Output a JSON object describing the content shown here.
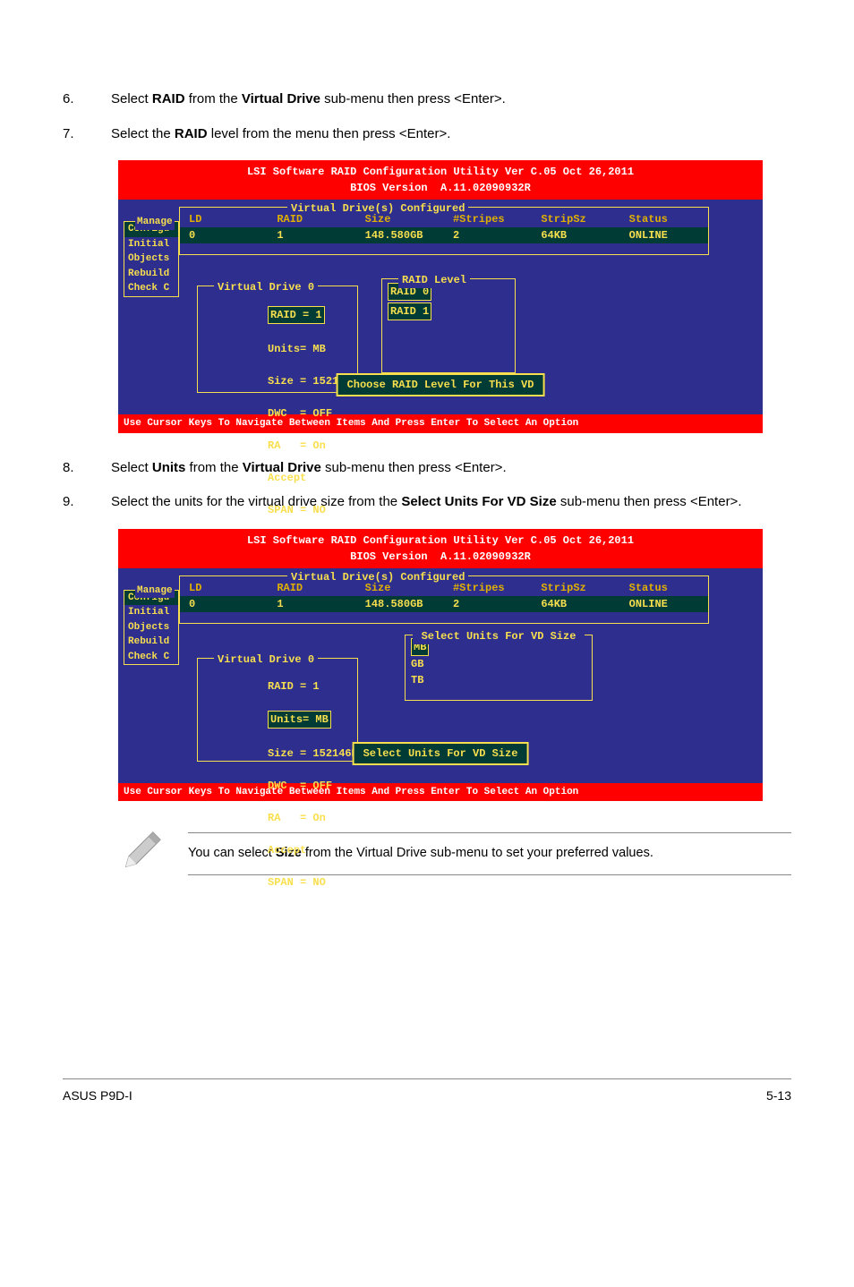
{
  "steps": {
    "s6": {
      "num": "6.",
      "prefix": "Select ",
      "bold1": "RAID",
      "mid": " from the ",
      "bold2": "Virtual Drive",
      "suffix": " sub-menu then press <Enter>."
    },
    "s7": {
      "num": "7.",
      "prefix": "Select the ",
      "bold1": "RAID",
      "suffix": " level from the menu then press <Enter>."
    },
    "s8": {
      "num": "8.",
      "prefix": "Select ",
      "bold1": "Units",
      "mid": " from the ",
      "bold2": "Virtual Drive",
      "suffix": " sub-menu then press <Enter>."
    },
    "s9": {
      "num": "9.",
      "prefix": "Select the units for the virtual drive size from the ",
      "bold1": "Select Units For VD Size",
      "suffix": " sub-menu then press <Enter>."
    }
  },
  "bios_common": {
    "title_line1": "LSI Software RAID Configuration Utility Ver C.05 Oct 26,2011",
    "title_line2": "BIOS Version  A.11.02090932R",
    "footer": "Use Cursor Keys To Navigate Between Items And Press Enter To Select An Option",
    "sidemenu_label": "Manage",
    "sidemenu": [
      "Configu",
      "Initial",
      "Objects",
      "Rebuild",
      "Check C"
    ],
    "config_title": "Virtual Drive(s) Configured",
    "headers": {
      "ld": "LD",
      "raid": "RAID",
      "size": "Size",
      "stripes": "#Stripes",
      "stripsz": "StripSz",
      "status": "Status"
    },
    "row": {
      "ld": "0",
      "raid": "1",
      "size": "148.580GB",
      "stripes": "2",
      "stripsz": "64KB",
      "status": "ONLINE"
    },
    "vdrive_title": "Virtual Drive 0",
    "vdrive_items": {
      "raid": "RAID = 1",
      "units": "Units= MB",
      "size": "Size = 152146MB",
      "dwc": "DWC  = OFF",
      "ra": "RA   = On",
      "accept": "Accept",
      "span": "SPAN = NO"
    }
  },
  "bios1": {
    "raidlevel_title": "RAID Level",
    "raid0": "RAID 0",
    "raid1": "RAID 1",
    "msg": "Choose RAID Level For This VD"
  },
  "bios2": {
    "units_box_title": "Select Units For VD Size",
    "units": {
      "mb": "MB",
      "gb": "GB",
      "tb": "TB"
    },
    "msg": "Select Units For VD Size"
  },
  "note": {
    "prefix": "You can select ",
    "bold": "Size",
    "suffix": " from the Virtual Drive sub-menu to set your preferred values."
  },
  "footer": {
    "left": "ASUS P9D-I",
    "right": "5-13"
  }
}
